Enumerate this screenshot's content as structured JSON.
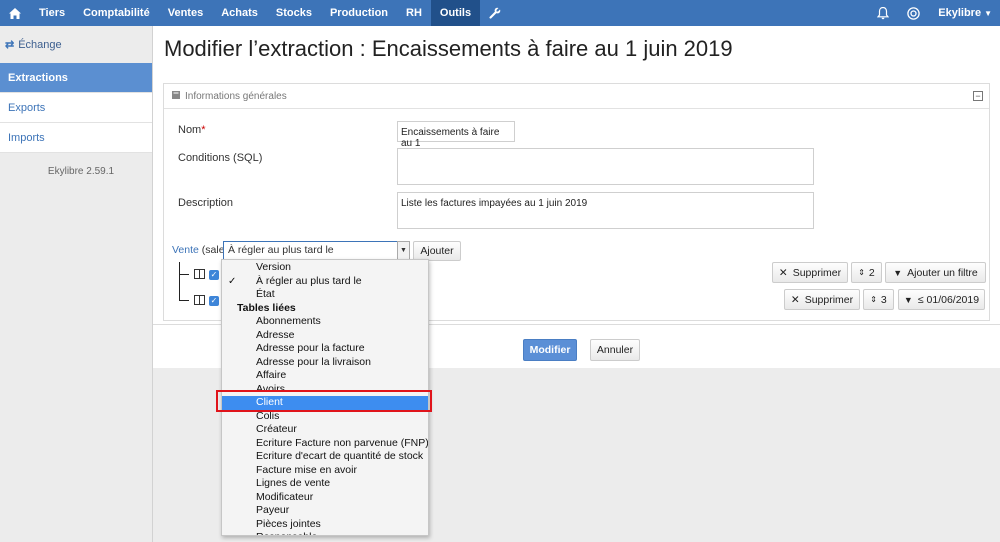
{
  "nav": {
    "items": [
      "Tiers",
      "Comptabilité",
      "Ventes",
      "Achats",
      "Stocks",
      "Production",
      "RH",
      "Outils"
    ],
    "active": "Outils",
    "user": "Ekylibre"
  },
  "sidebar": {
    "heading": "Échange",
    "items": [
      "Extractions",
      "Exports",
      "Imports"
    ],
    "active": "Extractions",
    "version": "Ekylibre 2.59.1"
  },
  "page": {
    "title": "Modifier l’extraction : Encaissements à faire au 1 juin 2019"
  },
  "panel": {
    "title": "Informations générales",
    "name_label": "Nom",
    "name_required_mark": "*",
    "name_value": "Encaissements à faire au 1",
    "conditions_label": "Conditions (SQL)",
    "conditions_value": "",
    "description_label": "Description",
    "description_value": "Liste les factures impayées au 1 juin 2019"
  },
  "builder": {
    "table_link": "Vente",
    "table_code": "(sale)",
    "select_value": "À régler au plus tard le",
    "add_button": "Ajouter",
    "row1": {
      "delete": "Supprimer",
      "count": "2",
      "filter": "Ajouter un filtre"
    },
    "row2": {
      "delete": "Supprimer",
      "count": "3",
      "filter": "≤ 01/06/2019"
    }
  },
  "actions": {
    "submit": "Modifier",
    "cancel": "Annuler"
  },
  "dropdown": {
    "items": [
      {
        "label": "Version",
        "type": "option"
      },
      {
        "label": "À régler au plus tard le",
        "type": "option",
        "checked": true
      },
      {
        "label": "État",
        "type": "option"
      },
      {
        "label": "Tables liées",
        "type": "group"
      },
      {
        "label": "Abonnements",
        "type": "option"
      },
      {
        "label": "Adresse",
        "type": "option"
      },
      {
        "label": "Adresse pour la facture",
        "type": "option"
      },
      {
        "label": "Adresse pour la livraison",
        "type": "option"
      },
      {
        "label": "Affaire",
        "type": "option"
      },
      {
        "label": "Avoirs",
        "type": "option"
      },
      {
        "label": "Client",
        "type": "option",
        "highlighted": true
      },
      {
        "label": "Colis",
        "type": "option"
      },
      {
        "label": "Créateur",
        "type": "option"
      },
      {
        "label": "Ecriture Facture non parvenue (FNP)",
        "type": "option"
      },
      {
        "label": "Ecriture d'ecart de quantité de stock",
        "type": "option"
      },
      {
        "label": "Facture mise en avoir",
        "type": "option"
      },
      {
        "label": "Lignes de vente",
        "type": "option"
      },
      {
        "label": "Modificateur",
        "type": "option"
      },
      {
        "label": "Payeur",
        "type": "option"
      },
      {
        "label": "Pièces jointes",
        "type": "option"
      },
      {
        "label": "Responsable",
        "type": "option"
      }
    ],
    "check_glyph": "✓"
  },
  "colors": {
    "nav_bg": "#3d74b8",
    "nav_active": "#21508a",
    "highlight": "#3d8df0",
    "annotation": "#e0141b"
  }
}
